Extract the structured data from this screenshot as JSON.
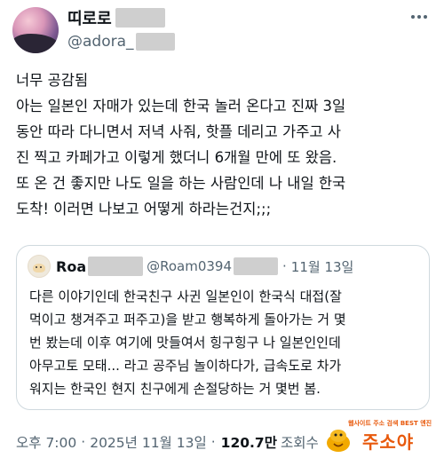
{
  "author": {
    "name": "띠로로",
    "handle": "@adora_"
  },
  "tweet": {
    "lines": [
      "너무 공감됨",
      "아는 일본인 자매가 있는데 한국 놀러 온다고 진짜 3일",
      "동안 따라 다니면서 저녁 사줘, 핫플 데리고 가주고 사",
      "진 찍고 카페가고 이렇게 했더니 6개월 만에 또 왔음.",
      "또 온 건 좋지만 나도 일을 하는 사람인데 나 내일 한국",
      "도착! 이러면 나보고 어떻게 하라는건지;;;"
    ]
  },
  "quote": {
    "name": "Roa",
    "handle": "@Roam0394",
    "separator": "·",
    "date": "11월 13일",
    "lines": [
      "다른 이야기인데 한국친구 사귄 일본인이 한국식 대접(잘",
      "먹이고 챙겨주고 퍼주고)을 받고 행복하게 돌아가는 거 몇",
      "번 봤는데 이후 여기에 맛들여서 힝구힝구 나 일본인인데",
      "아무고토 모태... 라고 공주님 놀이하다가, 급속도로 차가",
      "워지는 한국인 현지 친구에게 손절당하는 거 몇번 봄."
    ]
  },
  "meta": {
    "time": "오후 7:00",
    "separator": "·",
    "date": "2025년 11월 13일",
    "separator2": "·",
    "views": "120.7만",
    "views_label": "조회수"
  },
  "watermark": {
    "top": "웹사이트 주소 검색 BEST 엔진",
    "main": "주소야"
  },
  "icons": {
    "more": "more-icon"
  },
  "colors": {
    "text": "#0f1419",
    "secondary": "#536471",
    "border": "#cfd9de",
    "watermark": "#e8590c"
  }
}
